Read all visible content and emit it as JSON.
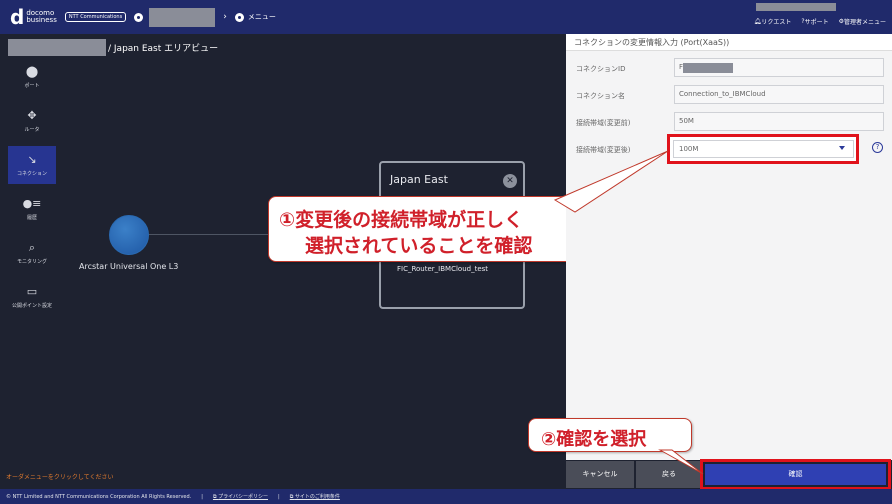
{
  "topbar": {
    "logo_main": "d",
    "logo_line1": "docomo",
    "logo_line2": "business",
    "ntt_badge": "NTT Communications",
    "menu_label": "メニュー",
    "links": [
      "リクエスト",
      "サポート",
      "管理者メニュー"
    ]
  },
  "area": {
    "title": "/ Japan East エリアビュー"
  },
  "nav": {
    "items": [
      {
        "label": "ポート",
        "icon": "port-icon"
      },
      {
        "label": "ルータ",
        "icon": "router-icon"
      },
      {
        "label": "コネクション",
        "icon": "connection-icon"
      },
      {
        "label": "履歴",
        "icon": "history-icon"
      },
      {
        "label": "モニタリング",
        "icon": "monitoring-icon"
      },
      {
        "label": "公開ポイント設定",
        "icon": "public-point-icon"
      }
    ]
  },
  "canvas": {
    "node_label": "Arcstar Universal One L3",
    "region_title": "Japan East",
    "router_label": "FIC_Router_IBMCloud_test"
  },
  "callouts": {
    "c1_line1": "①変更後の接続帯域が正しく",
    "c1_line2": "選択されていることを確認",
    "c2": "②確認を選択"
  },
  "note": "オーダメニューをクリックしてください",
  "panel": {
    "title": "コネクションの変更情報入力 (Port(XaaS))",
    "fields": [
      {
        "label": "コネクションID",
        "value": "F"
      },
      {
        "label": "コネクション名",
        "value": "Connection_to_IBMCloud"
      },
      {
        "label": "接続帯域(変更前)",
        "value": "50M"
      },
      {
        "label": "接続帯域(変更後)",
        "value": "100M"
      }
    ],
    "help": "?"
  },
  "buttons": {
    "cancel": "キャンセル",
    "back": "戻る",
    "confirm": "確認"
  },
  "footer": {
    "copyright": "© NTT Limited and NTT Communications Corporation All Rights Reserved.",
    "privacy": "プライバシーポリシー",
    "terms": "サイトのご利用条件"
  },
  "colors": {
    "topbar": "#202a6b",
    "accent_red": "#e0121b",
    "confirm_button": "#2f40b3",
    "nav_active": "#273591"
  }
}
